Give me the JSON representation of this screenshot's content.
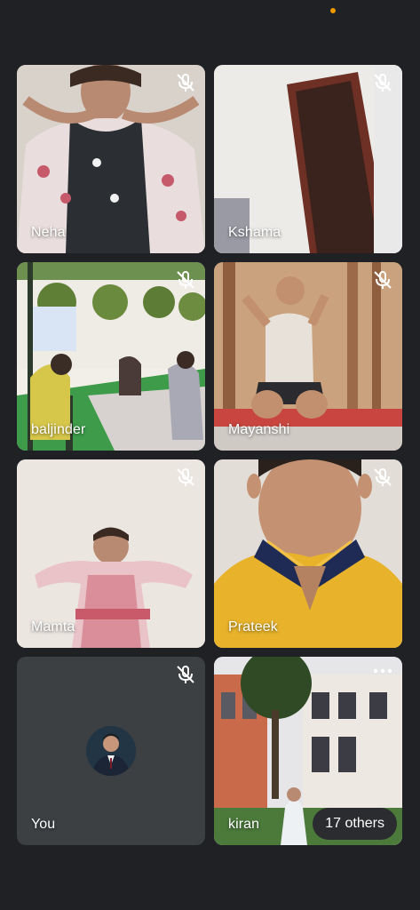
{
  "participants": [
    {
      "name": "Neha",
      "muted": true
    },
    {
      "name": "Kshama",
      "muted": true
    },
    {
      "name": "baljinder",
      "muted": true
    },
    {
      "name": "Mayanshi",
      "muted": true
    },
    {
      "name": "Mamta",
      "muted": true
    },
    {
      "name": "Prateek",
      "muted": true
    },
    {
      "name": "You",
      "muted": true
    },
    {
      "name": "kiran",
      "muted": false
    }
  ],
  "others_label": "17 others",
  "icons": {
    "mic": "mic-off-icon",
    "more": "more-options-icon"
  },
  "colors": {
    "background": "#202124",
    "recording_dot": "#f29900",
    "self_tile": "#3c4043"
  }
}
